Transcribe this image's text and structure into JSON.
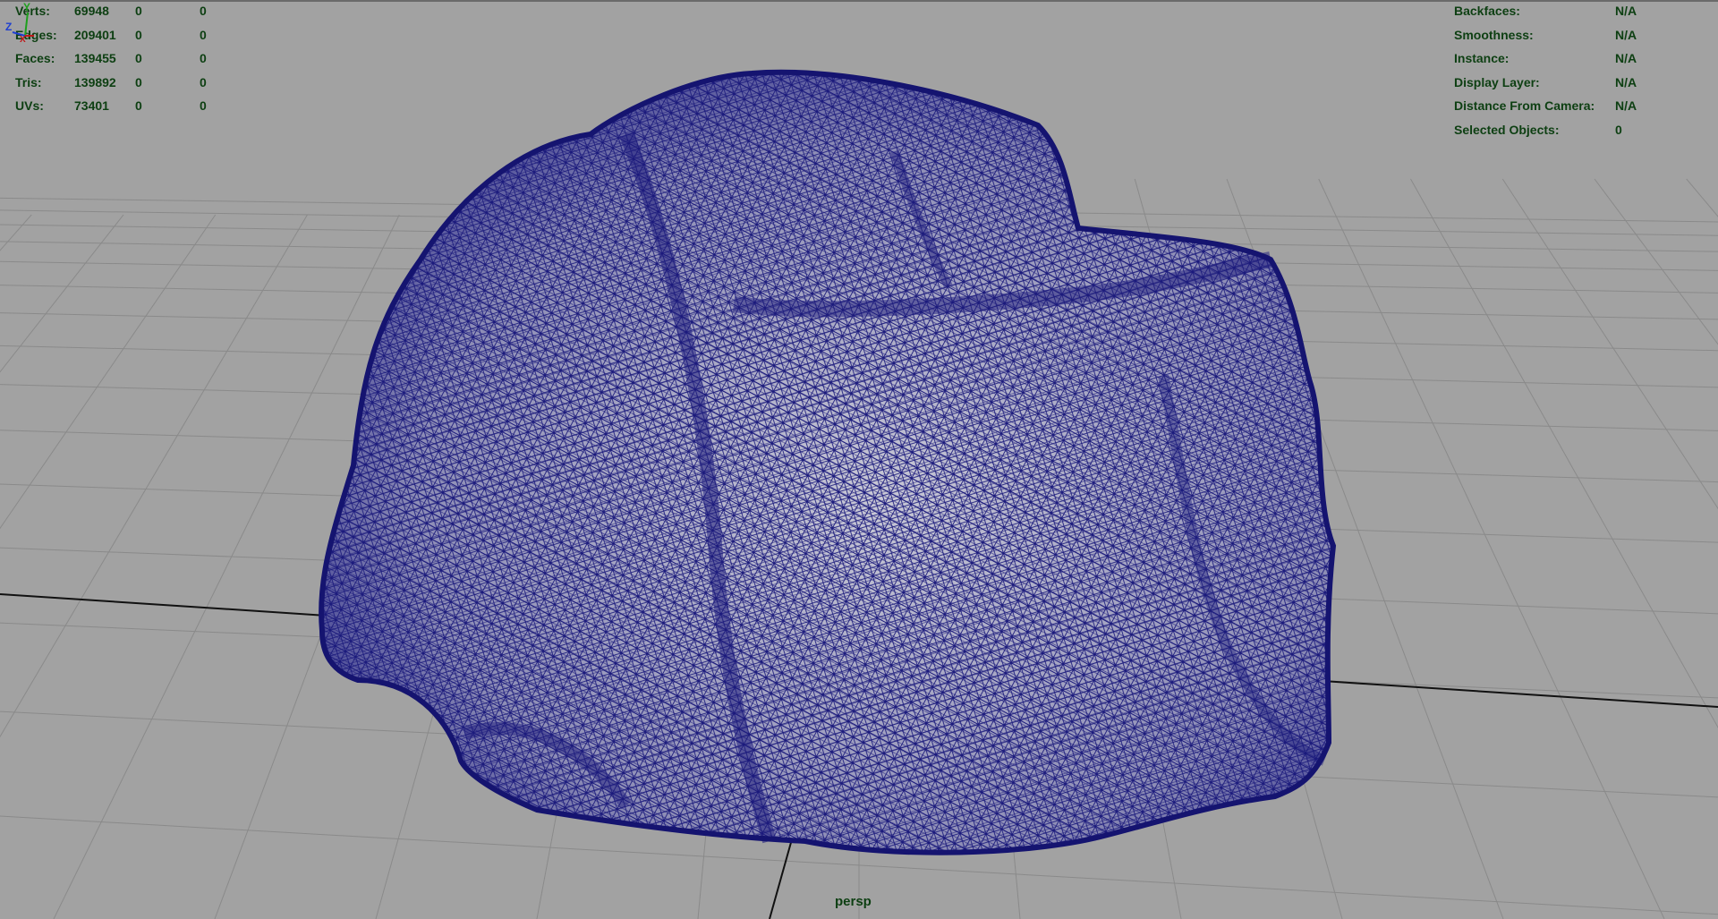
{
  "viewport": {
    "camera": "persp",
    "background_color": "#a2a2a2",
    "wire_color": "#1b1a7c",
    "hud_text_color": "#0d3f12"
  },
  "poly_count": [
    {
      "label": "Verts:",
      "total": "69948",
      "selected": "0",
      "component": "0"
    },
    {
      "label": "Edges:",
      "total": "209401",
      "selected": "0",
      "component": "0"
    },
    {
      "label": "Faces:",
      "total": "139455",
      "selected": "0",
      "component": "0"
    },
    {
      "label": "Tris:",
      "total": "139892",
      "selected": "0",
      "component": "0"
    },
    {
      "label": "UVs:",
      "total": "73401",
      "selected": "0",
      "component": "0"
    }
  ],
  "object_details": [
    {
      "label": "Backfaces:",
      "value": "N/A"
    },
    {
      "label": "Smoothness:",
      "value": "N/A"
    },
    {
      "label": "Instance:",
      "value": "N/A"
    },
    {
      "label": "Display Layer:",
      "value": "N/A"
    },
    {
      "label": "Distance From Camera:",
      "value": "N/A"
    },
    {
      "label": "Selected Objects:",
      "value": "0"
    }
  ],
  "axis": {
    "x": "X",
    "y": "Y",
    "z": "Z"
  }
}
